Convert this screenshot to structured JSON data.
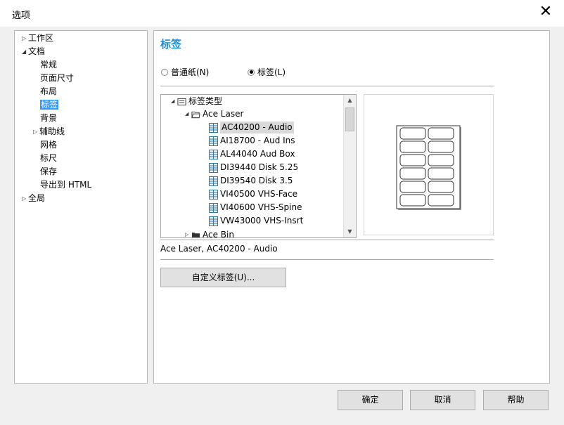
{
  "window": {
    "title": "选项",
    "close_symbol": "✕"
  },
  "sidebar": {
    "items": [
      {
        "label": "工作区",
        "arrow": "▷"
      },
      {
        "label": "文档",
        "arrow": "◢"
      },
      {
        "label": "常规"
      },
      {
        "label": "页面尺寸"
      },
      {
        "label": "布局"
      },
      {
        "label": "标签"
      },
      {
        "label": "背景"
      },
      {
        "label": "辅助线",
        "arrow": "▷"
      },
      {
        "label": "网格"
      },
      {
        "label": "标尺"
      },
      {
        "label": "保存"
      },
      {
        "label": "导出到 HTML"
      },
      {
        "label": "全局",
        "arrow": "▷"
      }
    ],
    "selected": "标签"
  },
  "main": {
    "title": "标签",
    "radio_plain": "普通纸(N)",
    "radio_label": "标签(L)",
    "selected_radio": "标签(L)",
    "label_tree": {
      "root": "标签类型",
      "group": "Ace Laser",
      "items": [
        "AC40200 - Audio",
        "AI18700 - Aud Ins",
        "AL44040 Aud Box",
        "DI39440 Disk 5.25",
        "DI39540 Disk 3.5",
        "VI40500 VHS-Face",
        "VI40600 VHS-Spine",
        "VW43000 VHS-Insrt"
      ],
      "selected": "AC40200 - Audio",
      "next_group": "Ace Bin"
    },
    "preview": {
      "columns": 2,
      "rows": 6
    },
    "selected_label": "Ace Laser, AC40200 - Audio",
    "custom_button": "自定义标签(U)..."
  },
  "footer": {
    "ok": "确定",
    "cancel": "取消",
    "help": "帮助"
  }
}
